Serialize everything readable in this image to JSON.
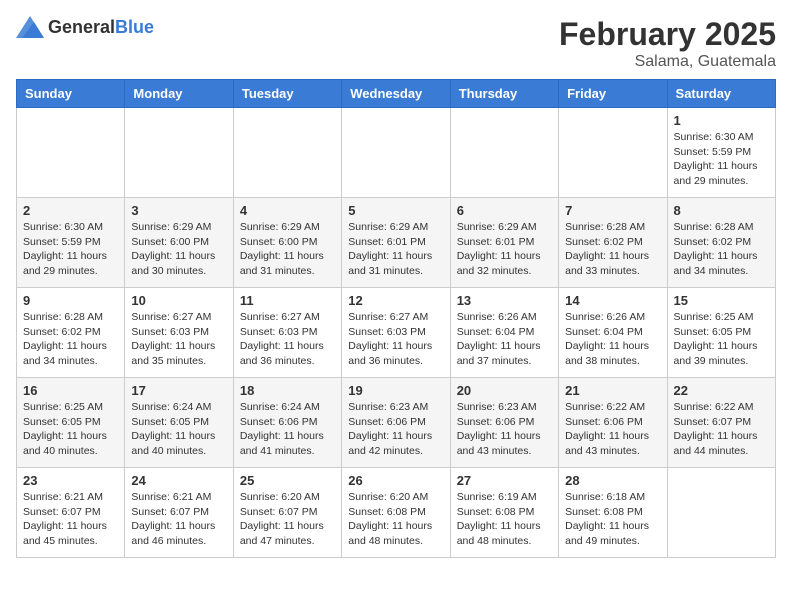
{
  "header": {
    "logo_general": "General",
    "logo_blue": "Blue",
    "month": "February 2025",
    "location": "Salama, Guatemala"
  },
  "weekdays": [
    "Sunday",
    "Monday",
    "Tuesday",
    "Wednesday",
    "Thursday",
    "Friday",
    "Saturday"
  ],
  "weeks": [
    [
      {
        "day": "",
        "info": ""
      },
      {
        "day": "",
        "info": ""
      },
      {
        "day": "",
        "info": ""
      },
      {
        "day": "",
        "info": ""
      },
      {
        "day": "",
        "info": ""
      },
      {
        "day": "",
        "info": ""
      },
      {
        "day": "1",
        "info": "Sunrise: 6:30 AM\nSunset: 5:59 PM\nDaylight: 11 hours\nand 29 minutes."
      }
    ],
    [
      {
        "day": "2",
        "info": "Sunrise: 6:30 AM\nSunset: 5:59 PM\nDaylight: 11 hours\nand 29 minutes."
      },
      {
        "day": "3",
        "info": "Sunrise: 6:29 AM\nSunset: 6:00 PM\nDaylight: 11 hours\nand 30 minutes."
      },
      {
        "day": "4",
        "info": "Sunrise: 6:29 AM\nSunset: 6:00 PM\nDaylight: 11 hours\nand 31 minutes."
      },
      {
        "day": "5",
        "info": "Sunrise: 6:29 AM\nSunset: 6:01 PM\nDaylight: 11 hours\nand 31 minutes."
      },
      {
        "day": "6",
        "info": "Sunrise: 6:29 AM\nSunset: 6:01 PM\nDaylight: 11 hours\nand 32 minutes."
      },
      {
        "day": "7",
        "info": "Sunrise: 6:28 AM\nSunset: 6:02 PM\nDaylight: 11 hours\nand 33 minutes."
      },
      {
        "day": "8",
        "info": "Sunrise: 6:28 AM\nSunset: 6:02 PM\nDaylight: 11 hours\nand 34 minutes."
      }
    ],
    [
      {
        "day": "9",
        "info": "Sunrise: 6:28 AM\nSunset: 6:02 PM\nDaylight: 11 hours\nand 34 minutes."
      },
      {
        "day": "10",
        "info": "Sunrise: 6:27 AM\nSunset: 6:03 PM\nDaylight: 11 hours\nand 35 minutes."
      },
      {
        "day": "11",
        "info": "Sunrise: 6:27 AM\nSunset: 6:03 PM\nDaylight: 11 hours\nand 36 minutes."
      },
      {
        "day": "12",
        "info": "Sunrise: 6:27 AM\nSunset: 6:03 PM\nDaylight: 11 hours\nand 36 minutes."
      },
      {
        "day": "13",
        "info": "Sunrise: 6:26 AM\nSunset: 6:04 PM\nDaylight: 11 hours\nand 37 minutes."
      },
      {
        "day": "14",
        "info": "Sunrise: 6:26 AM\nSunset: 6:04 PM\nDaylight: 11 hours\nand 38 minutes."
      },
      {
        "day": "15",
        "info": "Sunrise: 6:25 AM\nSunset: 6:05 PM\nDaylight: 11 hours\nand 39 minutes."
      }
    ],
    [
      {
        "day": "16",
        "info": "Sunrise: 6:25 AM\nSunset: 6:05 PM\nDaylight: 11 hours\nand 40 minutes."
      },
      {
        "day": "17",
        "info": "Sunrise: 6:24 AM\nSunset: 6:05 PM\nDaylight: 11 hours\nand 40 minutes."
      },
      {
        "day": "18",
        "info": "Sunrise: 6:24 AM\nSunset: 6:06 PM\nDaylight: 11 hours\nand 41 minutes."
      },
      {
        "day": "19",
        "info": "Sunrise: 6:23 AM\nSunset: 6:06 PM\nDaylight: 11 hours\nand 42 minutes."
      },
      {
        "day": "20",
        "info": "Sunrise: 6:23 AM\nSunset: 6:06 PM\nDaylight: 11 hours\nand 43 minutes."
      },
      {
        "day": "21",
        "info": "Sunrise: 6:22 AM\nSunset: 6:06 PM\nDaylight: 11 hours\nand 43 minutes."
      },
      {
        "day": "22",
        "info": "Sunrise: 6:22 AM\nSunset: 6:07 PM\nDaylight: 11 hours\nand 44 minutes."
      }
    ],
    [
      {
        "day": "23",
        "info": "Sunrise: 6:21 AM\nSunset: 6:07 PM\nDaylight: 11 hours\nand 45 minutes."
      },
      {
        "day": "24",
        "info": "Sunrise: 6:21 AM\nSunset: 6:07 PM\nDaylight: 11 hours\nand 46 minutes."
      },
      {
        "day": "25",
        "info": "Sunrise: 6:20 AM\nSunset: 6:07 PM\nDaylight: 11 hours\nand 47 minutes."
      },
      {
        "day": "26",
        "info": "Sunrise: 6:20 AM\nSunset: 6:08 PM\nDaylight: 11 hours\nand 48 minutes."
      },
      {
        "day": "27",
        "info": "Sunrise: 6:19 AM\nSunset: 6:08 PM\nDaylight: 11 hours\nand 48 minutes."
      },
      {
        "day": "28",
        "info": "Sunrise: 6:18 AM\nSunset: 6:08 PM\nDaylight: 11 hours\nand 49 minutes."
      },
      {
        "day": "",
        "info": ""
      }
    ]
  ]
}
